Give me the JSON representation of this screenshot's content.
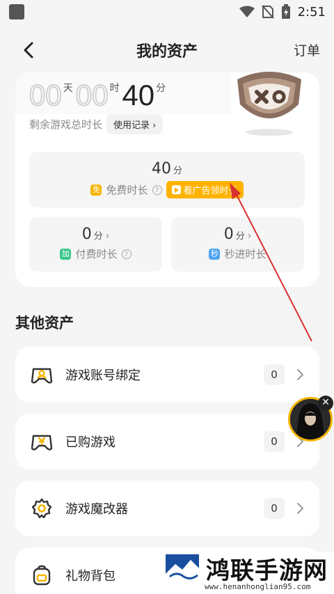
{
  "status_bar": {
    "time": "2:51"
  },
  "header": {
    "title": "我的资产",
    "orders": "订单"
  },
  "assets": {
    "days_value": "00",
    "days_unit": "天",
    "hours_value": "00",
    "hours_unit": "时",
    "minutes_value": "40",
    "minutes_unit": "分",
    "remaining_label": "剩余游戏总时长",
    "usage_button": "使用记录",
    "free": {
      "value": "40",
      "unit": "分",
      "tag": "免",
      "label": "免费时长",
      "ad_button": "看广告领时长"
    },
    "paid": {
      "value": "0",
      "unit": "分",
      "tag": "加",
      "label": "付费时长"
    },
    "instant": {
      "value": "0",
      "unit": "分",
      "tag": "秒",
      "label": "秒进时长"
    }
  },
  "other_assets": {
    "title": "其他资产",
    "items": [
      {
        "label": "游戏账号绑定",
        "count": "0",
        "icon": "gamepad-account-icon"
      },
      {
        "label": "已购游戏",
        "count": "0",
        "icon": "gamepad-purchased-icon"
      },
      {
        "label": "游戏魔改器",
        "count": "0",
        "icon": "gear-icon"
      },
      {
        "label": "礼物背包",
        "count": "",
        "icon": "backpack-icon"
      }
    ]
  },
  "watermark": {
    "title": "鸿联手游网",
    "url": "www.henanhonglian95.com"
  },
  "colors": {
    "accent": "#ffb300",
    "free_tag": "#f5b400",
    "paid_tag": "#3cc68a",
    "instant_tag": "#4aa3f0",
    "arrow": "#d9302f"
  }
}
